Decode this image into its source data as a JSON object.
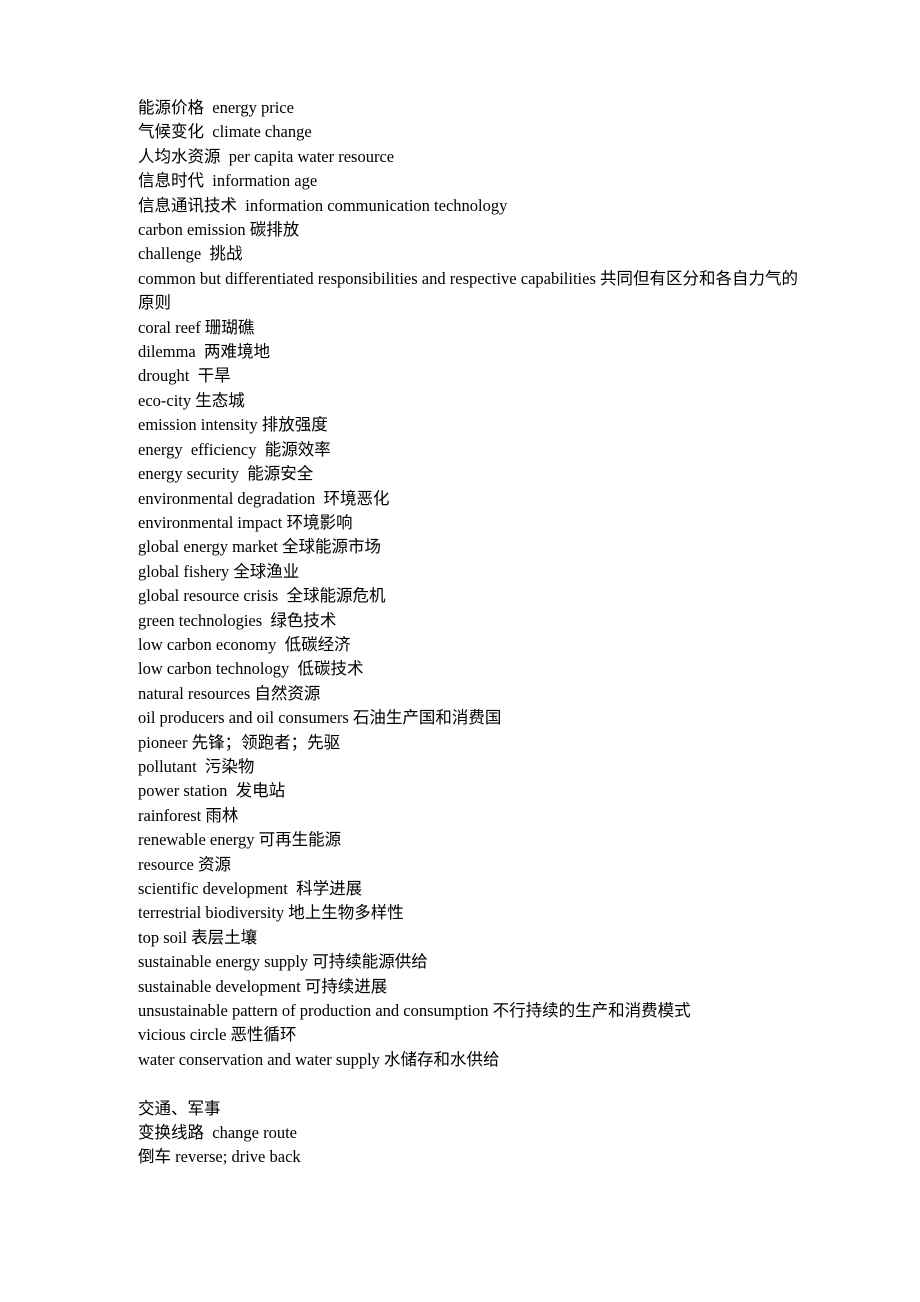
{
  "document": {
    "page_background": "#ffffff",
    "text_color": "#000000",
    "sections": [
      {
        "id": "energy-environment-glossary",
        "heading": "",
        "lines": [
          "能源价格  energy price",
          "气候变化  climate change",
          "人均水资源  per capita water resource",
          "信息时代  information age",
          "信息通讯技术  information communication technology",
          "carbon emission 碳排放",
          "challenge  挑战",
          "common but differentiated responsibilities and respective capabilities 共同但有区分和各自力气的原则",
          "coral reef 珊瑚礁",
          "dilemma  两难境地",
          "drought  干旱",
          "eco-city 生态城",
          "emission intensity 排放强度",
          "energy  efficiency  能源效率",
          "energy security  能源安全",
          "environmental degradation  环境恶化",
          "environmental impact 环境影响",
          "global energy market 全球能源市场",
          "global fishery 全球渔业",
          "global resource crisis  全球能源危机",
          "green technologies  绿色技术",
          "low carbon economy  低碳经济",
          "low carbon technology  低碳技术",
          "natural resources 自然资源",
          "oil producers and oil consumers 石油生产国和消费国",
          "pioneer 先锋；领跑者；先驱",
          "pollutant  污染物",
          "power station  发电站",
          "rainforest 雨林",
          "renewable energy 可再生能源",
          "resource 资源",
          "scientific development  科学进展",
          "terrestrial biodiversity 地上生物多样性",
          "top soil 表层土壤",
          "sustainable energy supply 可持续能源供给",
          "sustainable development 可持续进展",
          "unsustainable pattern of production and consumption 不行持续的生产和消费模式",
          "vicious circle 恶性循环",
          "water conservation and water supply 水储存和水供给"
        ]
      },
      {
        "id": "transport-military-glossary",
        "heading": "交通、军事",
        "lines": [
          "变换线路  change route",
          "倒车 reverse; drive back"
        ]
      }
    ]
  }
}
